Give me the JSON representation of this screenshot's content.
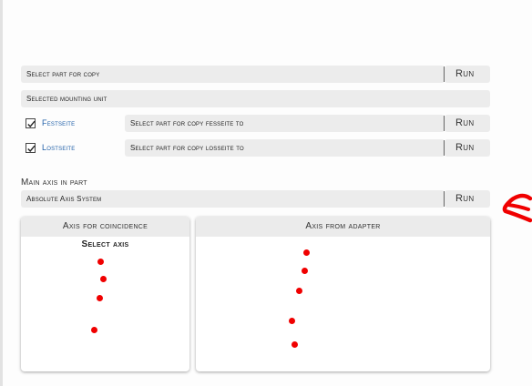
{
  "rows": {
    "select_part": {
      "label": "Select part for copy",
      "run": "Run"
    },
    "mounting_unit": {
      "label": "Selected mounting unit"
    },
    "festseite": {
      "checkbox_label": "Festseite",
      "checked": true,
      "label": "Select part for copy fesseite to",
      "run": "Run"
    },
    "lostseite": {
      "checkbox_label": "Lostseite",
      "checked": true,
      "label": "Select part for copy losseite to",
      "run": "Run"
    }
  },
  "main_axis": {
    "section_label": "Main axis in part",
    "field": "Absolute Axis System",
    "run": "Run"
  },
  "panels": {
    "coincidence": {
      "header": "Axis for coincidence",
      "subtitle": "Select axis"
    },
    "adapter": {
      "header": "Axis from adapter"
    }
  },
  "annotation": {
    "color": "#f00000",
    "icon": "red-hand-drawn-arrow"
  },
  "colors": {
    "link": "#1f5fa8",
    "field_bg": "#ececec",
    "dot": "#f00000"
  }
}
